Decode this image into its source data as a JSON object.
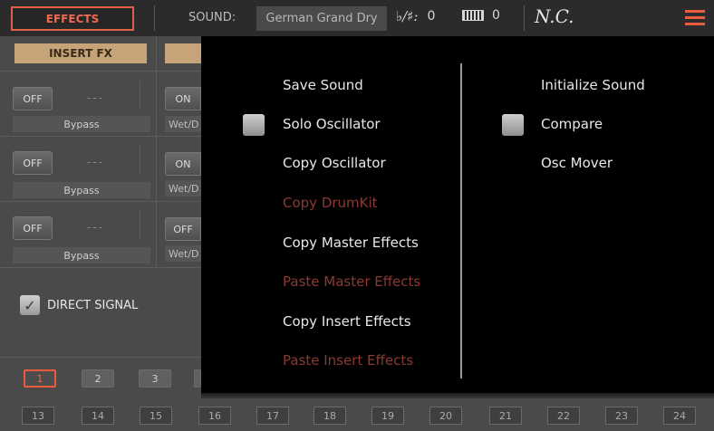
{
  "topbar": {
    "effects_tab": "EFFECTS",
    "sound_label": "SOUND:",
    "sound_name": "German Grand Dry",
    "transpose_glyph": "♭/♯:",
    "transpose_value": "0",
    "octave_value": "0",
    "chord": "N.C."
  },
  "panel": {
    "insert_fx_label": "INSERT FX",
    "slots": [
      {
        "state": "OFF",
        "dash": "---",
        "label": "Bypass",
        "right_state": "ON",
        "right_label": "Wet/D"
      },
      {
        "state": "OFF",
        "dash": "---",
        "label": "Bypass",
        "right_state": "ON",
        "right_label": "Wet/D"
      },
      {
        "state": "OFF",
        "dash": "---",
        "label": "Bypass",
        "right_state": "OFF",
        "right_label": "Wet/D"
      }
    ],
    "direct_signal": "DIRECT SIGNAL",
    "tracks_top": [
      "1",
      "2",
      "3"
    ],
    "tracks_bottom": [
      "13",
      "14",
      "15",
      "16",
      "17",
      "18",
      "19",
      "20",
      "21",
      "22",
      "23",
      "24"
    ]
  },
  "popup": {
    "left_items": [
      {
        "label": "Save Sound"
      },
      {
        "label": "Solo Oscillator"
      },
      {
        "label": "Copy Oscillator"
      },
      {
        "label": "Copy DrumKit"
      },
      {
        "label": "Copy Master Effects"
      },
      {
        "label": "Paste Master Effects"
      },
      {
        "label": "Copy Insert Effects"
      },
      {
        "label": "Paste Insert Effects"
      }
    ],
    "right_items": [
      {
        "label": "Initialize Sound"
      },
      {
        "label": "Compare"
      },
      {
        "label": "Osc Mover"
      }
    ]
  },
  "colors": {
    "accent": "#e85c3c",
    "insert_fx_bg": "#c7a37a",
    "popup_bg": "#000000",
    "disabled_text": "#8a3a30"
  },
  "icons": [
    "keyboard-icon",
    "menu-list-icon",
    "checkmark-icon"
  ]
}
